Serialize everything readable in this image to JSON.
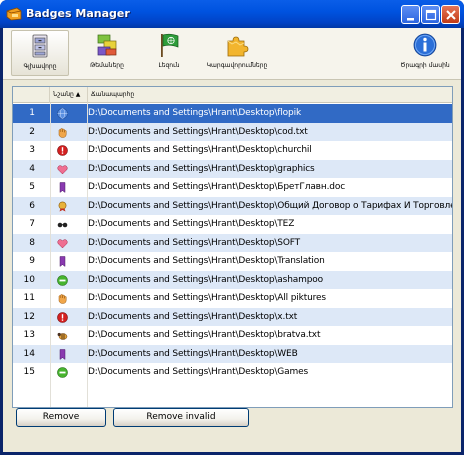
{
  "window": {
    "title": "Badges Manager",
    "controls": [
      "minimize",
      "maximize",
      "close"
    ]
  },
  "toolbar": {
    "items": [
      {
        "label": "Գլխավորը",
        "icon": "cabinet-icon"
      },
      {
        "label": "Թեմաները",
        "icon": "blocks-icon"
      },
      {
        "label": "Լեզուն",
        "icon": "flag-icon"
      },
      {
        "label": "Կարգավորումները",
        "icon": "puzzle-icon"
      },
      {
        "label": "Ծրագրի մասին",
        "icon": "info-icon"
      }
    ]
  },
  "grid": {
    "columns": [
      "",
      "Նշանը",
      "Ճանապարհը"
    ],
    "sorted_column": "Նշանը",
    "selected_row": 1,
    "rows": [
      {
        "num": "1",
        "badge": "globe",
        "path": "D:\\Documents and Settings\\Hrant\\Desktop\\flopik"
      },
      {
        "num": "2",
        "badge": "hand",
        "path": "D:\\Documents and Settings\\Hrant\\Desktop\\cod.txt"
      },
      {
        "num": "3",
        "badge": "warning",
        "path": "D:\\Documents and Settings\\Hrant\\Desktop\\churchil"
      },
      {
        "num": "4",
        "badge": "heart",
        "path": "D:\\Documents and Settings\\Hrant\\Desktop\\graphics"
      },
      {
        "num": "5",
        "badge": "bookmark",
        "path": "D:\\Documents and Settings\\Hrant\\Desktop\\БретГлавн.doc"
      },
      {
        "num": "6",
        "badge": "medal",
        "path": "D:\\Documents and Settings\\Hrant\\Desktop\\Общий Договор о Тарифах И Торговле.doc"
      },
      {
        "num": "7",
        "badge": "glasses",
        "path": "D:\\Documents and Settings\\Hrant\\Desktop\\TEZ"
      },
      {
        "num": "8",
        "badge": "heart",
        "path": "D:\\Documents and Settings\\Hrant\\Desktop\\SOFT"
      },
      {
        "num": "9",
        "badge": "bookmark",
        "path": "D:\\Documents and Settings\\Hrant\\Desktop\\Translation"
      },
      {
        "num": "10",
        "badge": "ok",
        "path": "D:\\Documents and Settings\\Hrant\\Desktop\\ashampoo"
      },
      {
        "num": "11",
        "badge": "hand",
        "path": "D:\\Documents and Settings\\Hrant\\Desktop\\All piktures"
      },
      {
        "num": "12",
        "badge": "warning",
        "path": "D:\\Documents and Settings\\Hrant\\Desktop\\x.txt"
      },
      {
        "num": "13",
        "badge": "bee",
        "path": "D:\\Documents and Settings\\Hrant\\Desktop\\bratva.txt"
      },
      {
        "num": "14",
        "badge": "bookmark",
        "path": "D:\\Documents and Settings\\Hrant\\Desktop\\WEB"
      },
      {
        "num": "15",
        "badge": "ok",
        "path": "D:\\Documents and Settings\\Hrant\\Desktop\\Games"
      }
    ]
  },
  "buttons": {
    "remove": "Remove",
    "remove_invalid": "Remove invalid"
  },
  "colors": {
    "titlebar": "#0053e0",
    "selection": "#316ac5",
    "alt_row": "#dde8f7"
  }
}
